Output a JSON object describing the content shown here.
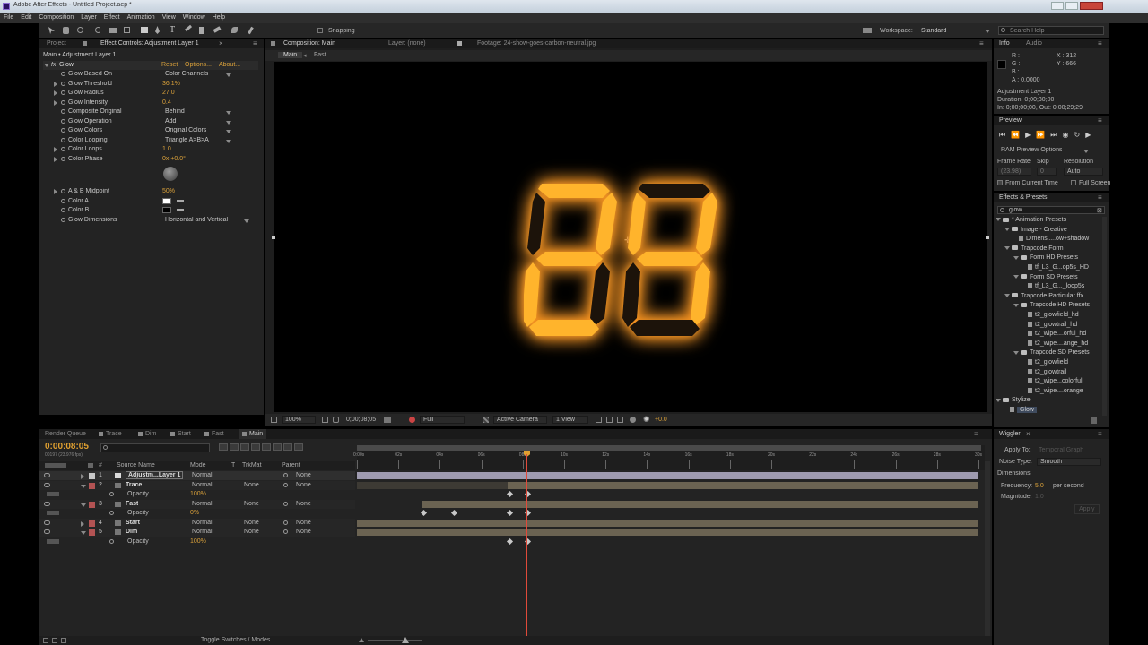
{
  "title": "Adobe After Effects - Untitled Project.aep *",
  "menu": [
    "File",
    "Edit",
    "Composition",
    "Layer",
    "Effect",
    "Animation",
    "View",
    "Window",
    "Help"
  ],
  "toolbar": {
    "snapping": "Snapping",
    "workspace_label": "Workspace:",
    "workspace_value": "Standard",
    "search_placeholder": "Search Help"
  },
  "effect_controls": {
    "tab_project": "Project",
    "tab_effect": "Effect Controls: Adjustment Layer 1",
    "breadcrumb": "Main • Adjustment Layer 1",
    "effect_name": "Glow",
    "reset": "Reset",
    "options": "Options...",
    "about": "About...",
    "props": [
      {
        "name": "Glow Based On",
        "type": "dd",
        "value": "Color Channels"
      },
      {
        "name": "Glow Threshold",
        "type": "num",
        "value": "36.1%"
      },
      {
        "name": "Glow Radius",
        "type": "num",
        "value": "27.0"
      },
      {
        "name": "Glow Intensity",
        "type": "num",
        "value": "0.4"
      },
      {
        "name": "Composite Original",
        "type": "dd",
        "value": "Behind"
      },
      {
        "name": "Glow Operation",
        "type": "dd",
        "value": "Add"
      },
      {
        "name": "Glow Colors",
        "type": "dd",
        "value": "Original Colors"
      },
      {
        "name": "Color Looping",
        "type": "dd",
        "value": "Triangle A>B>A"
      },
      {
        "name": "Color Loops",
        "type": "num",
        "value": "1.0"
      },
      {
        "name": "Color Phase",
        "type": "num",
        "value": "0x +0.0°"
      }
    ],
    "props2": [
      {
        "name": "A & B Midpoint",
        "type": "num",
        "value": "50%"
      },
      {
        "name": "Color A",
        "type": "color",
        "value": "#ffffff"
      },
      {
        "name": "Color B",
        "type": "color",
        "value": "#000000"
      },
      {
        "name": "Glow Dimensions",
        "type": "dd",
        "value": "Horizontal and Vertical"
      }
    ]
  },
  "comp": {
    "tab_comp": "Composition: Main",
    "tab_layer": "Layer: (none)",
    "tab_footage": "Footage: 24-show-goes-carbon-neutral.jpg",
    "sub_main": "Main",
    "sub_fast": "Fast",
    "display": "24",
    "zoom": "100%",
    "time": "0;00;08;05",
    "resolution": "Full",
    "camera": "Active Camera",
    "view": "1 View",
    "exposure": "+0.0"
  },
  "info": {
    "tab_info": "Info",
    "tab_audio": "Audio",
    "r": "R :",
    "g": "G :",
    "b": "B :",
    "a": "A : 0.0000",
    "x": "X : 312",
    "y": "Y : 666",
    "layer": "Adjustment Layer 1",
    "duration": "Duration: 0;00;30;00",
    "inout": "In: 0;00;00;00, Out: 0;00;29;29"
  },
  "preview": {
    "tab": "Preview",
    "ram": "RAM Preview Options",
    "frame_rate": "Frame Rate",
    "skip": "Skip",
    "resolution": "Resolution",
    "fr_value": "(23.98)",
    "skip_value": "0",
    "res_value": "Auto",
    "from_current": "From Current Time",
    "full_screen": "Full Screen"
  },
  "effects_presets": {
    "tab": "Effects & Presets",
    "search": "glow",
    "tree": [
      {
        "label": "* Animation Presets",
        "depth": 0,
        "kind": "folder"
      },
      {
        "label": "Image - Creative",
        "depth": 1,
        "kind": "folder"
      },
      {
        "label": "Dimensi....ow+shadow",
        "depth": 2,
        "kind": "file"
      },
      {
        "label": "Trapcode Form",
        "depth": 1,
        "kind": "folder"
      },
      {
        "label": "Form HD Presets",
        "depth": 2,
        "kind": "folder"
      },
      {
        "label": "tf_L3_G...op5s_HD",
        "depth": 3,
        "kind": "file"
      },
      {
        "label": "Form SD Presets",
        "depth": 2,
        "kind": "folder"
      },
      {
        "label": "tf_L3_G..._loop5s",
        "depth": 3,
        "kind": "file"
      },
      {
        "label": "Trapcode Particular ffx",
        "depth": 1,
        "kind": "folder"
      },
      {
        "label": "Trapcode HD Presets",
        "depth": 2,
        "kind": "folder"
      },
      {
        "label": "t2_glowfield_hd",
        "depth": 3,
        "kind": "file"
      },
      {
        "label": "t2_glowtrail_hd",
        "depth": 3,
        "kind": "file"
      },
      {
        "label": "t2_wipe....orful_hd",
        "depth": 3,
        "kind": "file"
      },
      {
        "label": "t2_wipe....ange_hd",
        "depth": 3,
        "kind": "file"
      },
      {
        "label": "Trapcode SD Presets",
        "depth": 2,
        "kind": "folder"
      },
      {
        "label": "t2_glowfield",
        "depth": 3,
        "kind": "file"
      },
      {
        "label": "t2_glowtrail",
        "depth": 3,
        "kind": "file"
      },
      {
        "label": "t2_wipe...colorful",
        "depth": 3,
        "kind": "file"
      },
      {
        "label": "t2_wipe....orange",
        "depth": 3,
        "kind": "file"
      },
      {
        "label": "Stylize",
        "depth": 0,
        "kind": "folder"
      },
      {
        "label": "Glow",
        "depth": 1,
        "kind": "file"
      }
    ]
  },
  "timeline": {
    "tabs": [
      "Render Queue",
      "Trace",
      "Dim",
      "Start",
      "Fast",
      "Main"
    ],
    "timecode": "0:00:08:05",
    "fps": "00197 (23.976 fps)",
    "col_source": "Source Name",
    "col_mode": "Mode",
    "col_t": "T",
    "col_trkmat": "TrkMat",
    "col_parent": "Parent",
    "ruler": [
      "0:00s",
      "02s",
      "04s",
      "06s",
      "08s",
      "10s",
      "12s",
      "14s",
      "16s",
      "18s",
      "20s",
      "22s",
      "24s",
      "26s",
      "28s",
      "30s"
    ],
    "layers": [
      {
        "num": "1",
        "name": "Adjustm...Layer 1",
        "mode": "Normal",
        "trkmat": "",
        "parent": "None"
      },
      {
        "num": "2",
        "name": "Trace",
        "mode": "Normal",
        "trkmat": "None",
        "parent": "None",
        "prop": "Opacity",
        "pval": "100%"
      },
      {
        "num": "3",
        "name": "Fast",
        "mode": "Normal",
        "trkmat": "None",
        "parent": "None",
        "prop": "Opacity",
        "pval": "0%"
      },
      {
        "num": "4",
        "name": "Start",
        "mode": "Normal",
        "trkmat": "None",
        "parent": "None"
      },
      {
        "num": "5",
        "name": "Dim",
        "mode": "Normal",
        "trkmat": "None",
        "parent": "None",
        "prop": "Opacity",
        "pval": "100%"
      }
    ],
    "toggle": "Toggle Switches / Modes"
  },
  "wiggler": {
    "tab": "Wiggler",
    "apply_to": "Apply To:",
    "apply_value": "Temporal Graph",
    "noise_type": "Noise Type:",
    "noise_value": "Smooth",
    "dimensions": "Dimensions:",
    "frequency": "Frequency:",
    "freq_value": "5.0",
    "per_second": "per second",
    "magnitude": "Magnitude:",
    "mag_value": "1.0",
    "apply": "Apply"
  }
}
